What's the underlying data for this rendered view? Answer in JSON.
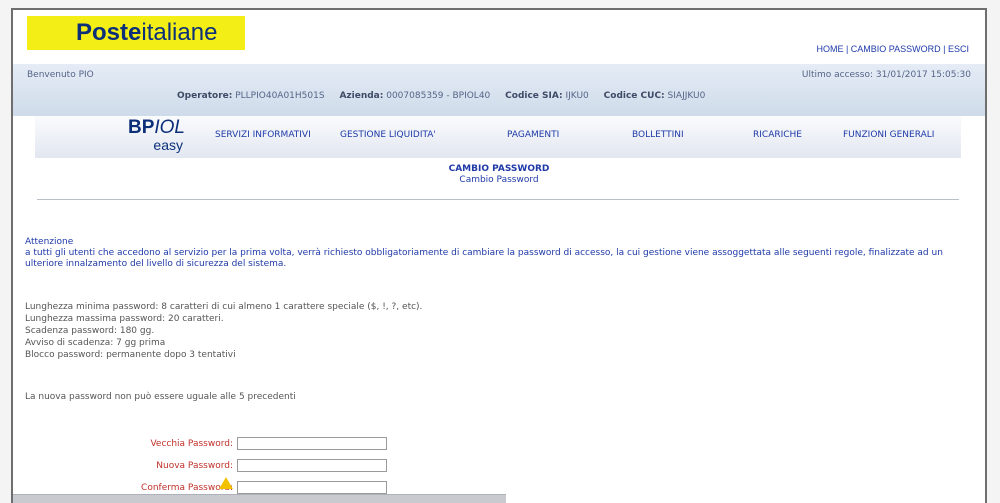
{
  "header": {
    "logo_bold": "Poste",
    "logo_rest": "italiane",
    "links": [
      "HOME",
      "CAMBIO PASSWORD",
      "ESCI"
    ],
    "separator": " | "
  },
  "userbar": {
    "welcome": "Benvenuto PIO",
    "last_access": "Ultimo accesso: 31/01/2017 15:05:30",
    "operatore_label": "Operatore:",
    "operatore_value": "PLLPIO40A01H501S",
    "azienda_label": "Azienda:",
    "azienda_value": "0007085359 - BPIOL40",
    "sia_label": "Codice SIA:",
    "sia_value": "IJKU0",
    "cuc_label": "Codice CUC:",
    "cuc_value": "SIAJJKU0"
  },
  "nav": {
    "brand_bp": "BP",
    "brand_iol": "IOL",
    "brand_easy": "easy",
    "items": [
      "SERVIZI INFORMATIVI",
      "GESTIONE LIQUIDITA'",
      "PAGAMENTI",
      "BOLLETTINI",
      "RICARICHE",
      "FUNZIONI GENERALI"
    ]
  },
  "page": {
    "title": "CAMBIO PASSWORD",
    "subtitle": "Cambio Password"
  },
  "attention": {
    "heading": "Attenzione",
    "text": "a tutti gli utenti che accedono al servizio per la prima volta, verrà richiesto obbligatoriamente di cambiare la password di accesso, la cui gestione viene assoggettata alle seguenti regole, finalizzate ad un ulteriore innalzamento del livello di sicurezza del sistema."
  },
  "rules": [
    "Lunghezza minima password: 8 caratteri di cui almeno 1 carattere speciale ($, !, ?, etc).",
    "Lunghezza massima password: 20 caratteri.",
    "Scadenza password: 180 gg.",
    "Avviso di scadenza: 7 gg prima",
    "Blocco password: permanente dopo 3 tentativi"
  ],
  "note": "La nuova password non può essere uguale alle 5 precedenti",
  "form": {
    "old_label": "Vecchia Password:",
    "new_label": "Nuova Password:",
    "confirm_label": "Conferma Password:",
    "old_value": "",
    "new_value": "",
    "confirm_value": ""
  },
  "colors": {
    "brand_yellow": "#f3ef16",
    "brand_blue": "#0c2f7a",
    "link_blue": "#1f3aa8",
    "label_red": "#c0312b"
  }
}
